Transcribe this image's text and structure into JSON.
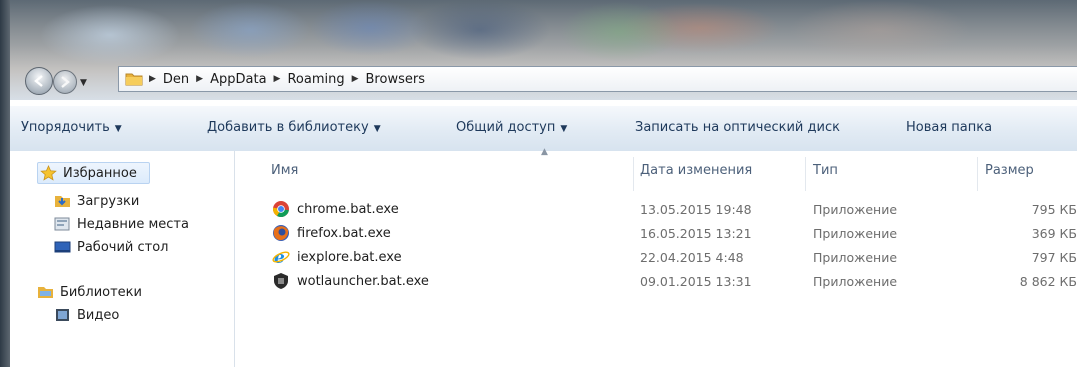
{
  "window": {
    "frame_color": "#2e3a46"
  },
  "address": {
    "crumbs": [
      {
        "label": "Den"
      },
      {
        "label": "AppData"
      },
      {
        "label": "Roaming"
      },
      {
        "label": "Browsers"
      }
    ]
  },
  "toolbar": {
    "organize": "Упорядочить",
    "add_to_library": "Добавить в библиотеку",
    "share": "Общий доступ",
    "burn": "Записать на оптический диск",
    "new_folder": "Новая папка",
    "caret": "▼"
  },
  "sidebar": {
    "favorites": {
      "label": "Избранное",
      "icon": "star-icon"
    },
    "items": [
      {
        "label": "Загрузки",
        "icon": "downloads-folder-icon"
      },
      {
        "label": "Недавние места",
        "icon": "recent-places-icon"
      },
      {
        "label": "Рабочий стол",
        "icon": "desktop-icon"
      }
    ],
    "libraries": {
      "label": "Библиотеки",
      "icon": "libraries-icon"
    },
    "library_items": [
      {
        "label": "Видео",
        "icon": "video-icon"
      }
    ]
  },
  "columns": {
    "name": "Имя",
    "date": "Дата изменения",
    "type": "Тип",
    "size": "Размер"
  },
  "files": [
    {
      "name": "chrome.bat.exe",
      "date": "13.05.2015 19:48",
      "type": "Приложение",
      "size": "795 КБ",
      "icon": "chrome-icon"
    },
    {
      "name": "firefox.bat.exe",
      "date": "16.05.2015 13:21",
      "type": "Приложение",
      "size": "369 КБ",
      "icon": "firefox-icon"
    },
    {
      "name": "iexplore.bat.exe",
      "date": "22.04.2015 4:48",
      "type": "Приложение",
      "size": "797 КБ",
      "icon": "internet-explorer-icon"
    },
    {
      "name": "wotlauncher.bat.exe",
      "date": "09.01.2015 13:31",
      "type": "Приложение",
      "size": "8 862 КБ",
      "icon": "wot-launcher-icon"
    }
  ],
  "colors": {
    "toolbar_text": "#1e395b",
    "column_header_text": "#4c607a",
    "secondary_text": "#6d6d6d"
  }
}
